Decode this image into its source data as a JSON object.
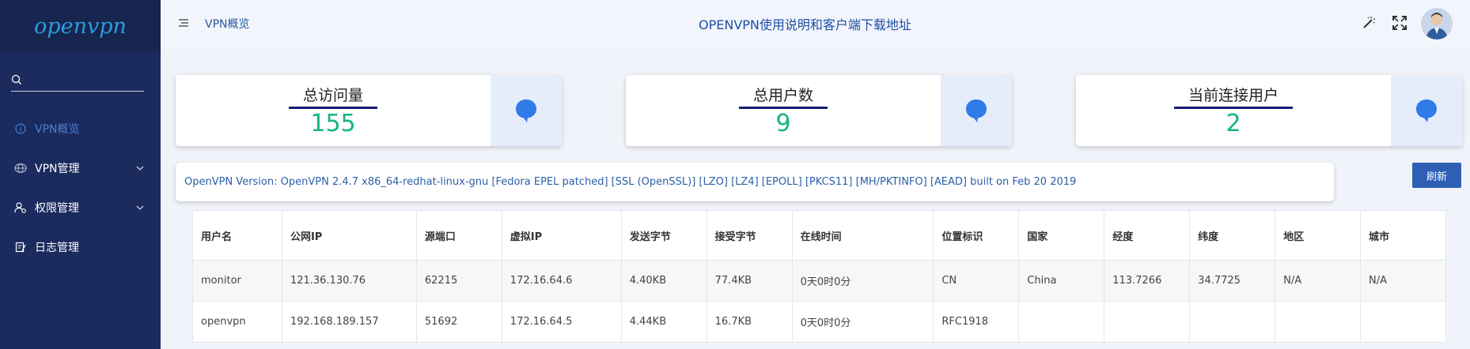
{
  "sidebar": {
    "logo": "openvpn",
    "menu": [
      {
        "label": "VPN概览",
        "icon": "info-icon"
      },
      {
        "label": "VPN管理",
        "icon": "vpn-icon"
      },
      {
        "label": "权限管理",
        "icon": "user-permission-icon"
      },
      {
        "label": "日志管理",
        "icon": "log-icon"
      }
    ]
  },
  "header": {
    "breadcrumb": "VPN概览",
    "link": "OPENVPN使用说明和客户端下载地址"
  },
  "cards": [
    {
      "title": "总访问量",
      "value": "155"
    },
    {
      "title": "总用户数",
      "value": "9"
    },
    {
      "title": "当前连接用户",
      "value": "2"
    }
  ],
  "version": "OpenVPN Version: OpenVPN 2.4.7 x86_64-redhat-linux-gnu [Fedora EPEL patched] [SSL (OpenSSL)] [LZO] [LZ4] [EPOLL] [PKCS11] [MH/PKTINFO] [AEAD] built on Feb 20 2019",
  "refresh_label": "刷新",
  "table": {
    "headers": [
      "用户名",
      "公网IP",
      "源端口",
      "虚拟IP",
      "发送字节",
      "接受字节",
      "在线时间",
      "位置标识",
      "国家",
      "经度",
      "纬度",
      "地区",
      "城市"
    ],
    "rows": [
      [
        "monitor",
        "121.36.130.76",
        "62215",
        "172.16.64.6",
        "4.40KB",
        "77.4KB",
        "0天0时0分",
        "CN",
        "China",
        "113.7266",
        "34.7725",
        "N/A",
        "N/A"
      ],
      [
        "openvpn",
        "192.168.189.157",
        "51692",
        "172.16.64.5",
        "4.44KB",
        "16.7KB",
        "0天0时0分",
        "RFC1918",
        "",
        "",
        "",
        "",
        ""
      ]
    ]
  },
  "colors": {
    "sidebar_bg": "#1b2b5e",
    "accent": "#2f5fb5",
    "value_green": "#15b385"
  }
}
